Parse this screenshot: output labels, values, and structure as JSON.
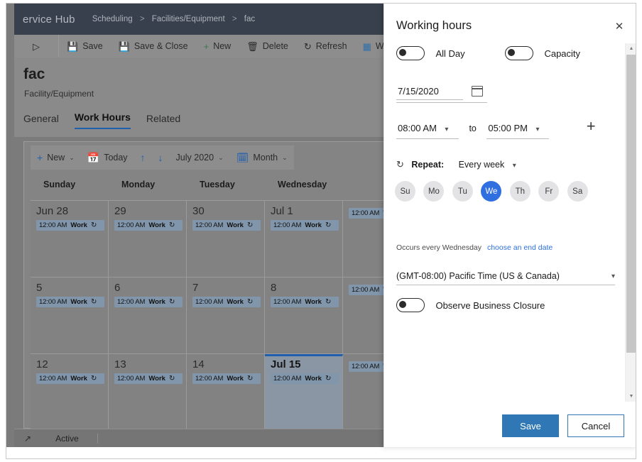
{
  "app": {
    "brand": "ervice Hub",
    "breadcrumb": [
      "Scheduling",
      "Facilities/Equipment",
      "fac"
    ],
    "breadcrumb_separator": ">"
  },
  "command_bar": {
    "collapse_icon": "chevron-right-circle-icon",
    "items": [
      {
        "label": "Save",
        "icon": "save-icon"
      },
      {
        "label": "Save & Close",
        "icon": "save-close-icon"
      },
      {
        "label": "New",
        "icon": "plus-icon"
      },
      {
        "label": "Delete",
        "icon": "trash-icon"
      },
      {
        "label": "Refresh",
        "icon": "refresh-icon"
      },
      {
        "label": "Work H",
        "icon": "work-hours-icon"
      }
    ]
  },
  "record": {
    "title": "fac",
    "subtitle": "Facility/Equipment",
    "tabs": [
      {
        "label": "General",
        "active": false
      },
      {
        "label": "Work Hours",
        "active": true
      },
      {
        "label": "Related",
        "active": false
      }
    ]
  },
  "calendar_toolbar": {
    "new_label": "New",
    "today_label": "Today",
    "prev_icon": "arrow-up-icon",
    "next_icon": "arrow-down-icon",
    "period_label": "July 2020",
    "view_label": "Month",
    "new_icon": "plus-icon",
    "today_icon": "calendar-today-icon",
    "view_icon": "calendar-month-icon",
    "chevron": "⌄"
  },
  "calendar": {
    "weekday_headers": [
      "Sunday",
      "Monday",
      "Tuesday",
      "Wednesday"
    ],
    "event_time": "12:00 AM",
    "event_label": "Work",
    "event_recurrence_icon": "recurrence-icon",
    "weeks": [
      [
        {
          "day": "Jun 28",
          "event": true,
          "selected": false
        },
        {
          "day": "29",
          "event": true,
          "selected": false
        },
        {
          "day": "30",
          "event": true,
          "selected": false
        },
        {
          "day": "Jul 1",
          "event": true,
          "selected": false
        },
        {
          "day": "",
          "event": true,
          "selected": false
        }
      ],
      [
        {
          "day": "5",
          "event": true,
          "selected": false
        },
        {
          "day": "6",
          "event": true,
          "selected": false
        },
        {
          "day": "7",
          "event": true,
          "selected": false
        },
        {
          "day": "8",
          "event": true,
          "selected": false
        },
        {
          "day": "",
          "event": true,
          "selected": false
        }
      ],
      [
        {
          "day": "12",
          "event": true,
          "selected": false
        },
        {
          "day": "13",
          "event": true,
          "selected": false
        },
        {
          "day": "14",
          "event": true,
          "selected": false
        },
        {
          "day": "Jul 15",
          "event": true,
          "selected": true
        },
        {
          "day": "",
          "event": true,
          "selected": false
        }
      ]
    ]
  },
  "status_bar": {
    "icon": "popout-icon",
    "text": "Active"
  },
  "panel": {
    "title": "Working hours",
    "close_icon": "close-icon",
    "all_day": {
      "label": "All Day",
      "on": false
    },
    "capacity": {
      "label": "Capacity",
      "on": false
    },
    "date": {
      "value": "7/15/2020",
      "icon": "calendar-icon"
    },
    "start_time": {
      "value": "08:00 AM"
    },
    "to_label": "to",
    "end_time": {
      "value": "05:00 PM"
    },
    "add_icon": "plus-icon",
    "repeat": {
      "icon": "recurrence-icon",
      "label": "Repeat:",
      "value": "Every week",
      "days": [
        {
          "label": "Su",
          "selected": false
        },
        {
          "label": "Mo",
          "selected": false
        },
        {
          "label": "Tu",
          "selected": false
        },
        {
          "label": "We",
          "selected": true
        },
        {
          "label": "Th",
          "selected": false
        },
        {
          "label": "Fr",
          "selected": false
        },
        {
          "label": "Sa",
          "selected": false
        }
      ],
      "occurs_text": "Occurs every Wednesday",
      "end_date_link": "choose an end date"
    },
    "timezone": {
      "value": "(GMT-08:00) Pacific Time (US & Canada)"
    },
    "business_closure": {
      "label": "Observe Business Closure",
      "on": false
    },
    "save_label": "Save",
    "cancel_label": "Cancel",
    "scroll_up_icon": "scroll-up-icon",
    "scroll_down_icon": "scroll-down-icon"
  },
  "colors": {
    "accent_blue": "#2f6fe0",
    "primary_button": "#2f77b5",
    "link_blue": "#2c6fd8",
    "topbar_navy": "#0d1b2e",
    "event_blue": "#8196ab",
    "taskbar_orange": "#c2702a"
  }
}
